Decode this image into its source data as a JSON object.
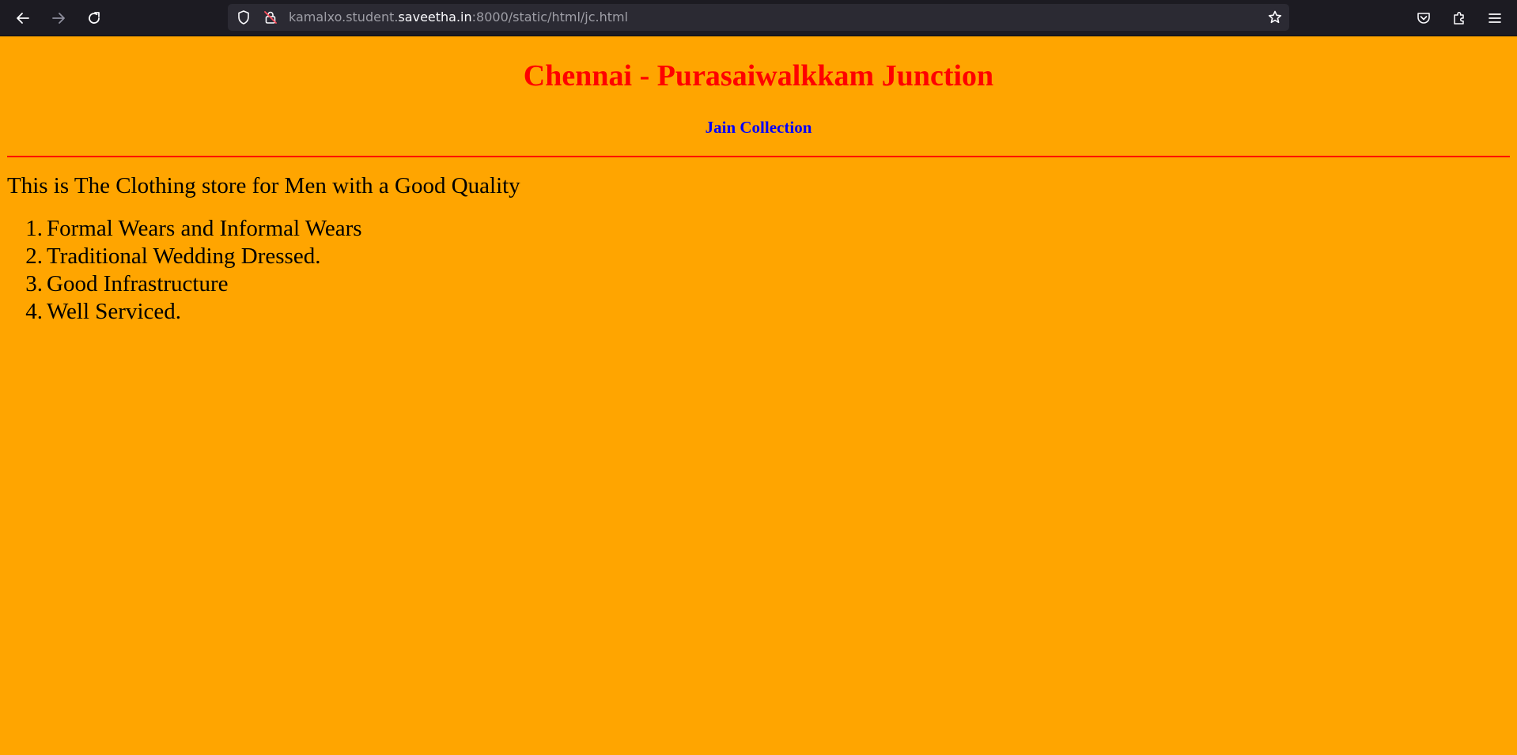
{
  "browser": {
    "url_prefix": "kamalxo.student.",
    "url_host": "saveetha.in",
    "url_suffix": ":8000/static/html/jc.html"
  },
  "page": {
    "title": "Chennai - Purasaiwalkkam Junction",
    "subtitle": "Jain Collection",
    "intro": "This is The Clothing store for Men with a Good Quality",
    "features": [
      {
        "num": "1.",
        "text": "Formal Wears and Informal Wears"
      },
      {
        "num": "2.",
        "text": "Traditional Wedding Dressed."
      },
      {
        "num": "3.",
        "text": "Good Infrastructure"
      },
      {
        "num": "4.",
        "text": "Well Serviced."
      }
    ]
  },
  "colors": {
    "background": "#ffa500",
    "title": "#ff0000",
    "subtitle": "#0000ff",
    "divider": "#ff0000"
  },
  "icons": [
    "back-arrow-icon",
    "forward-arrow-icon",
    "reload-icon",
    "shield-icon",
    "lock-icon",
    "bookmark-star-icon",
    "pocket-icon",
    "extensions-icon",
    "menu-icon"
  ]
}
